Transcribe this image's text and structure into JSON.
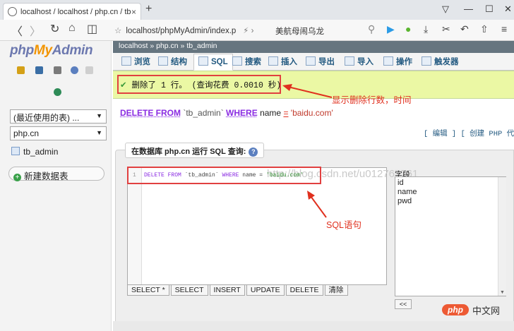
{
  "browser": {
    "tab_title": "localhost / localhost / php.cn / tb",
    "new_tab": "+",
    "url": "localhost/phpMyAdmin/index.p",
    "bookmark": "美航母闹乌龙"
  },
  "logo": {
    "part1": "php",
    "part2": "My",
    "part3": "Admin"
  },
  "left": {
    "recent": "(最近使用的表) ...",
    "database": "php.cn",
    "table": "tb_admin",
    "new_table": "新建数据表"
  },
  "breadcrumb": "localhost   » php.cn   » tb_admin",
  "tabs": [
    "浏览",
    "结构",
    "SQL",
    "搜索",
    "插入",
    "导出",
    "导入",
    "操作",
    "触发器"
  ],
  "success": {
    "message": "删除了 1 行。 (查询花费 0.0010 秒)"
  },
  "annotations": {
    "deleted_rows": "显示删除行数，时间",
    "sql": "SQL语句"
  },
  "query": {
    "kw1": "DELETE FROM",
    "table": "`tb_admin`",
    "kw2": "WHERE",
    "field": "name",
    "op": "=",
    "value": "'baidu.com'"
  },
  "actions": "[ 编辑 ] [ 创建 PHP 代码 ]",
  "panel": {
    "legend": "在数据库 php.cn 运行 SQL 查询:",
    "help": "?",
    "line_no": "1",
    "code": {
      "k1": "DELETE FROM",
      "t": "`tb_admin`",
      "k2": "WHERE",
      "f": "name",
      "eq": "=",
      "v": "'baidu.com'"
    },
    "watermark": "http://blog.csdn.net/u012767761",
    "buttons": [
      "SELECT *",
      "SELECT",
      "INSERT",
      "UPDATE",
      "DELETE",
      "清除"
    ],
    "fields_label": "字段",
    "fields": [
      "id",
      "name",
      "pwd"
    ],
    "insert_btn": "<<"
  },
  "watermark_logo": {
    "oval": "php",
    "text": "中文网"
  }
}
